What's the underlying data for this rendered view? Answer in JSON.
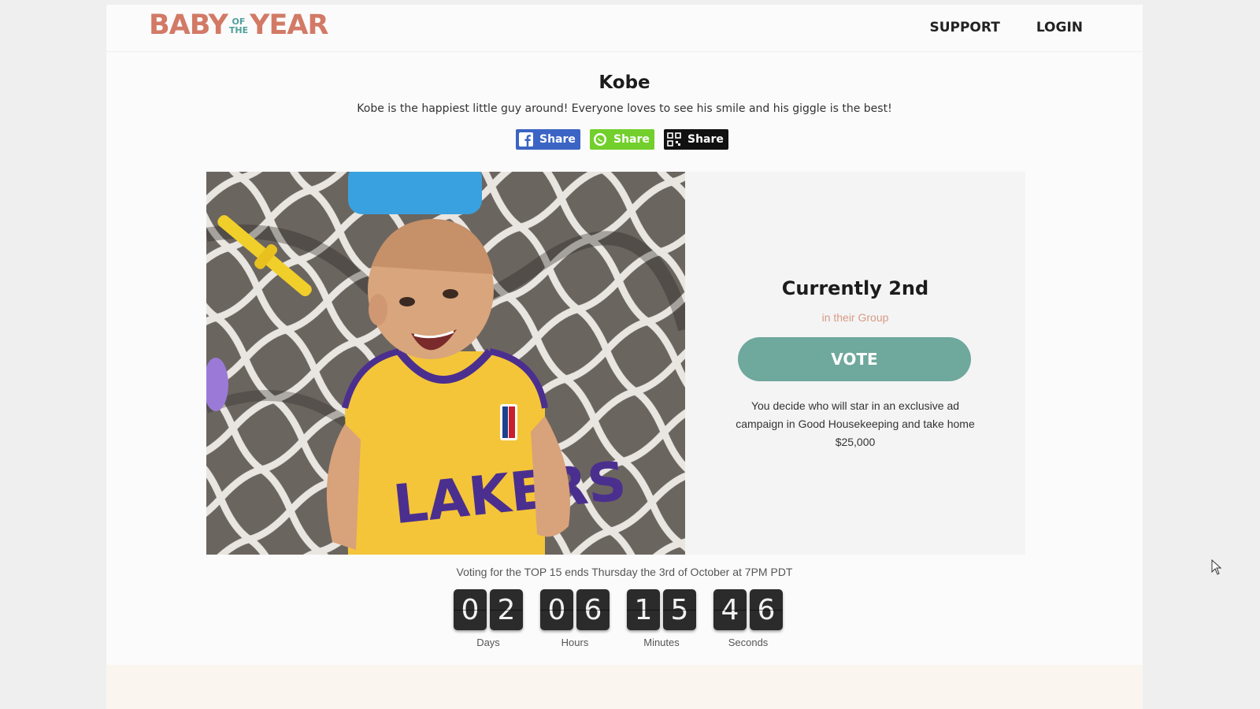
{
  "brand": {
    "logo_left": "BABY",
    "logo_of": "OF",
    "logo_the": "THE",
    "logo_right": "YEAR"
  },
  "nav": {
    "support": "SUPPORT",
    "login": "LOGIN"
  },
  "entry": {
    "name": "Kobe",
    "description": "Kobe is the happiest little guy around! Everyone loves to see his smile and his giggle is the best!",
    "photo_icon": "baby-photo"
  },
  "share": {
    "facebook": "Share",
    "whatsapp": "Share",
    "qr": "Share"
  },
  "ranking": {
    "status": "Currently 2nd",
    "context": "in their Group",
    "vote_label": "VOTE",
    "prize_text": "You decide who will star in an exclusive ad campaign in Good Housekeeping and take home $25,000"
  },
  "countdown": {
    "note": "Voting for the TOP 15 ends Thursday the 3rd of October at 7PM PDT",
    "days": [
      "0",
      "2"
    ],
    "hours": [
      "0",
      "6"
    ],
    "minutes": [
      "1",
      "5"
    ],
    "seconds": [
      "4",
      "6"
    ],
    "days_label": "Days",
    "hours_label": "Hours",
    "minutes_label": "Minutes",
    "seconds_label": "Seconds"
  },
  "colors": {
    "brand_coral": "#d27a66",
    "brand_teal": "#4f9f9a",
    "vote_green": "#6fa89c",
    "facebook_blue": "#3b64c4",
    "whatsapp_green": "#72cf2c"
  }
}
